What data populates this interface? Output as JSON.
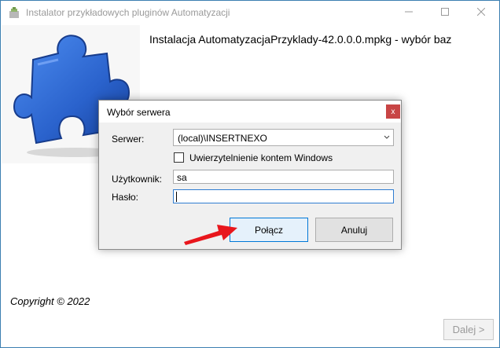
{
  "window": {
    "title": "Instalator przykładowych pluginów Automatyzacji",
    "header": "Instalacja AutomatyzacjaPrzyklady-42.0.0.0.mpkg - wybór baz",
    "copyright": "Copyright © 2022",
    "next_label": "Dalej >",
    "icons": [
      "installer-icon",
      "minimize-icon",
      "maximize-icon",
      "close-icon",
      "puzzle-icon"
    ]
  },
  "dialog": {
    "title": "Wybór serwera",
    "close_label": "x",
    "server_label": "Serwer:",
    "server_value": "(local)\\INSERTNEXO",
    "windows_auth_label": "Uwierzytelnienie kontem Windows",
    "windows_auth_checked": false,
    "user_label": "Użytkownik:",
    "user_value": "sa",
    "password_label": "Hasło:",
    "password_value": "",
    "connect_label": "Połącz",
    "cancel_label": "Anuluj"
  },
  "colors": {
    "accent": "#0078d7",
    "close_button": "#c84545",
    "arrow": "#e8161c",
    "puzzle": "#2f6fd6"
  }
}
